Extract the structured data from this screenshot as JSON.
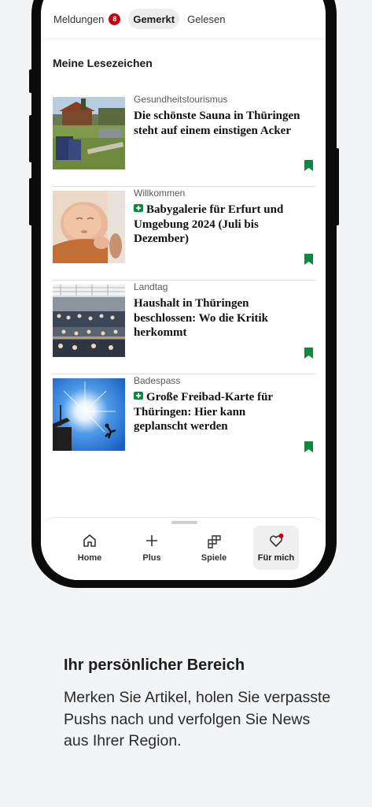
{
  "tabs": [
    {
      "label": "Meldungen",
      "badge": "8"
    },
    {
      "label": "Gemerkt"
    },
    {
      "label": "Gelesen"
    }
  ],
  "section_title": "Meine Lesezeichen",
  "articles": [
    {
      "kicker": "Gesundheitstourismus",
      "headline": "Die schönste Sauna in Thüringen steht auf einem einstigen Acker",
      "plus": false
    },
    {
      "kicker": "Willkommen",
      "headline": "Babygalerie für Erfurt und Umgebung 2024 (Juli bis Dezember)",
      "plus": true
    },
    {
      "kicker": "Landtag",
      "headline": "Haushalt in Thüringen beschlossen: Wo die Kritik herkommt",
      "plus": false
    },
    {
      "kicker": "Badespass",
      "headline": "Große Freibad-Karte für Thüringen: Hier kann geplanscht werden",
      "plus": true
    }
  ],
  "nav": [
    {
      "label": "Home",
      "icon": "home-icon"
    },
    {
      "label": "Plus",
      "icon": "plus-icon"
    },
    {
      "label": "Spiele",
      "icon": "puzzle-icon"
    },
    {
      "label": "Für mich",
      "icon": "heart-icon"
    }
  ],
  "promo": {
    "title": "Ihr persönlicher Bereich",
    "text": "Merken Sie Artikel, holen Sie verpasste Pushs nach und verfolgen Sie News aus Ihrer Region."
  },
  "colors": {
    "accent_red": "#c8000f",
    "plus_green": "#0a8a3c"
  }
}
